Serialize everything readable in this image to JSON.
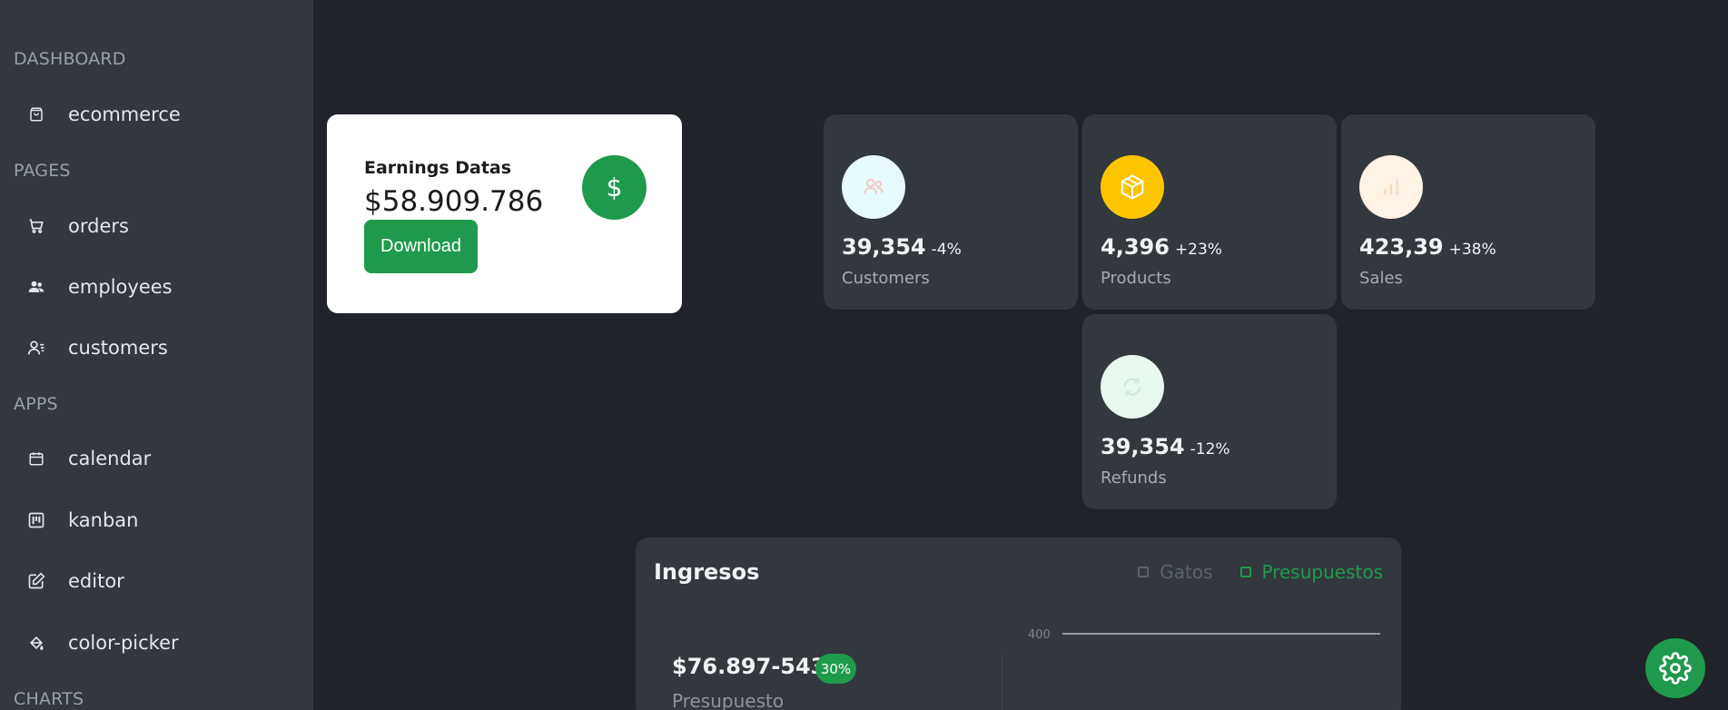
{
  "sidebar": {
    "sections": [
      {
        "label": "DASHBOARD"
      },
      {
        "label": "PAGES"
      },
      {
        "label": "APPS"
      },
      {
        "label": "CHARTS"
      }
    ],
    "items": [
      {
        "label": "ecommerce",
        "icon": "bag-icon"
      },
      {
        "label": "orders",
        "icon": "cart-icon"
      },
      {
        "label": "employees",
        "icon": "team-icon"
      },
      {
        "label": "customers",
        "icon": "user-list-icon"
      },
      {
        "label": "calendar",
        "icon": "calendar-icon"
      },
      {
        "label": "kanban",
        "icon": "kanban-icon"
      },
      {
        "label": "editor",
        "icon": "edit-icon"
      },
      {
        "label": "color-picker",
        "icon": "paint-bucket-icon"
      }
    ]
  },
  "earnings": {
    "title": "Earnings Datas",
    "value": "$58.909.786",
    "button": "Download",
    "icon_symbol": "$",
    "accent": "#1f9a4c"
  },
  "stats": [
    {
      "value": "39,354",
      "pct": "-4%",
      "caption": "Customers",
      "icon": "users-icon",
      "icon_bg": "#e6f9fb"
    },
    {
      "value": "4,396",
      "pct": "+23%",
      "caption": "Products",
      "icon": "box-icon",
      "icon_bg": "#fdc500"
    },
    {
      "value": "423,39",
      "pct": "+38%",
      "caption": "Sales",
      "icon": "bar-chart-icon",
      "icon_bg": "#fff3e6"
    },
    {
      "value": "39,354",
      "pct": "-12%",
      "caption": "Refunds",
      "icon": "refresh-icon",
      "icon_bg": "#e8f8ee"
    }
  ],
  "revenue": {
    "title": "Ingresos",
    "legend": [
      {
        "label": "Gatos",
        "color": "#5b616a"
      },
      {
        "label": "Presupuestos",
        "color": "#1f9a4c"
      }
    ],
    "budget_value": "$76.897-543",
    "budget_badge": "30%",
    "budget_caption": "Presupuesto",
    "chart_tick": "400"
  }
}
